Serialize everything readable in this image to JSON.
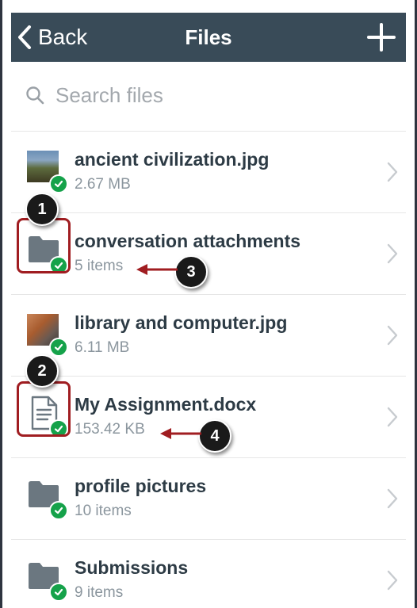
{
  "nav": {
    "back_label": "Back",
    "title": "Files",
    "add_icon": "plus-icon",
    "back_icon": "chevron-left-icon"
  },
  "search": {
    "placeholder": "Search files",
    "icon": "search-icon"
  },
  "files": [
    {
      "name": "ancient civilization.jpg",
      "meta": "2.67 MB",
      "kind": "image",
      "synced": true
    },
    {
      "name": "conversation attachments",
      "meta": "5 items",
      "kind": "folder",
      "synced": true
    },
    {
      "name": "library and computer.jpg",
      "meta": "6.11 MB",
      "kind": "image",
      "synced": true
    },
    {
      "name": "My Assignment.docx",
      "meta": "153.42 KB",
      "kind": "document",
      "synced": true
    },
    {
      "name": "profile pictures",
      "meta": "10 items",
      "kind": "folder",
      "synced": true
    },
    {
      "name": "Submissions",
      "meta": "9 items",
      "kind": "folder",
      "synced": true
    }
  ],
  "callouts": [
    "1",
    "2",
    "3",
    "4"
  ],
  "colors": {
    "navbar": "#394b58",
    "synced_check": "#15a24a",
    "callout_red": "#a01d21",
    "folder_gray": "#6b7780"
  }
}
